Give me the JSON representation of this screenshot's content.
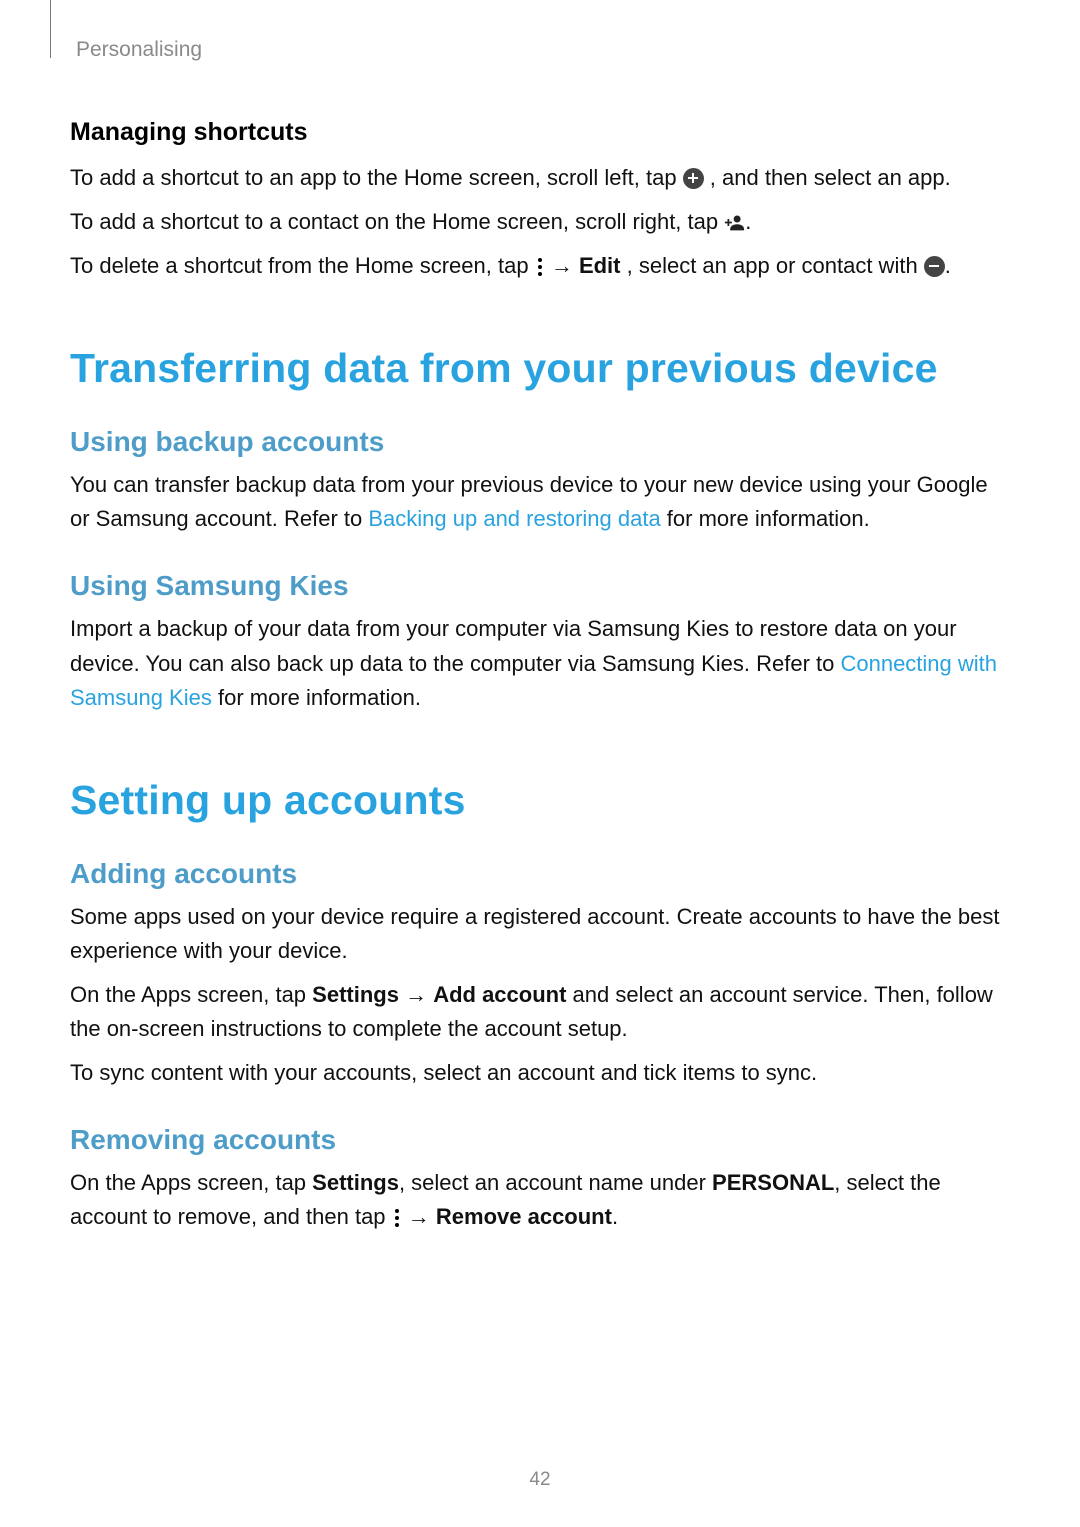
{
  "header": {
    "running_head": "Personalising"
  },
  "shortcuts": {
    "heading": "Managing shortcuts",
    "p1a": "To add a shortcut to an app to the Home screen, scroll left, tap ",
    "p1b": ", and then select an app.",
    "p2a": "To add a shortcut to a contact on the Home screen, scroll right, tap ",
    "p2b": ".",
    "p3a": "To delete a shortcut from the Home screen, tap ",
    "p3b": " → ",
    "p3c": "Edit",
    "p3d": ", select an app or contact with ",
    "p3e": "."
  },
  "transfer": {
    "heading": "Transferring data from your previous device",
    "backup": {
      "heading": "Using backup accounts",
      "p1a": "You can transfer backup data from your previous device to your new device using your Google or Samsung account. Refer to ",
      "link": "Backing up and restoring data",
      "p1b": " for more information."
    },
    "kies": {
      "heading": "Using Samsung Kies",
      "p1a": "Import a backup of your data from your computer via Samsung Kies to restore data on your device. You can also back up data to the computer via Samsung Kies. Refer to ",
      "link": "Connecting with Samsung Kies",
      "p1b": " for more information."
    }
  },
  "accounts": {
    "heading": "Setting up accounts",
    "adding": {
      "heading": "Adding accounts",
      "p1": "Some apps used on your device require a registered account. Create accounts to have the best experience with your device.",
      "p2a": "On the Apps screen, tap ",
      "p2b": "Settings",
      "p2c": " → ",
      "p2d": "Add account",
      "p2e": " and select an account service. Then, follow the on-screen instructions to complete the account setup.",
      "p3": "To sync content with your accounts, select an account and tick items to sync."
    },
    "removing": {
      "heading": "Removing accounts",
      "p1a": "On the Apps screen, tap ",
      "p1b": "Settings",
      "p1c": ", select an account name under ",
      "p1d": "PERSONAL",
      "p1e": ", select the account to remove, and then tap ",
      "p1f": " → ",
      "p1g": "Remove account",
      "p1h": "."
    }
  },
  "page_number": "42"
}
